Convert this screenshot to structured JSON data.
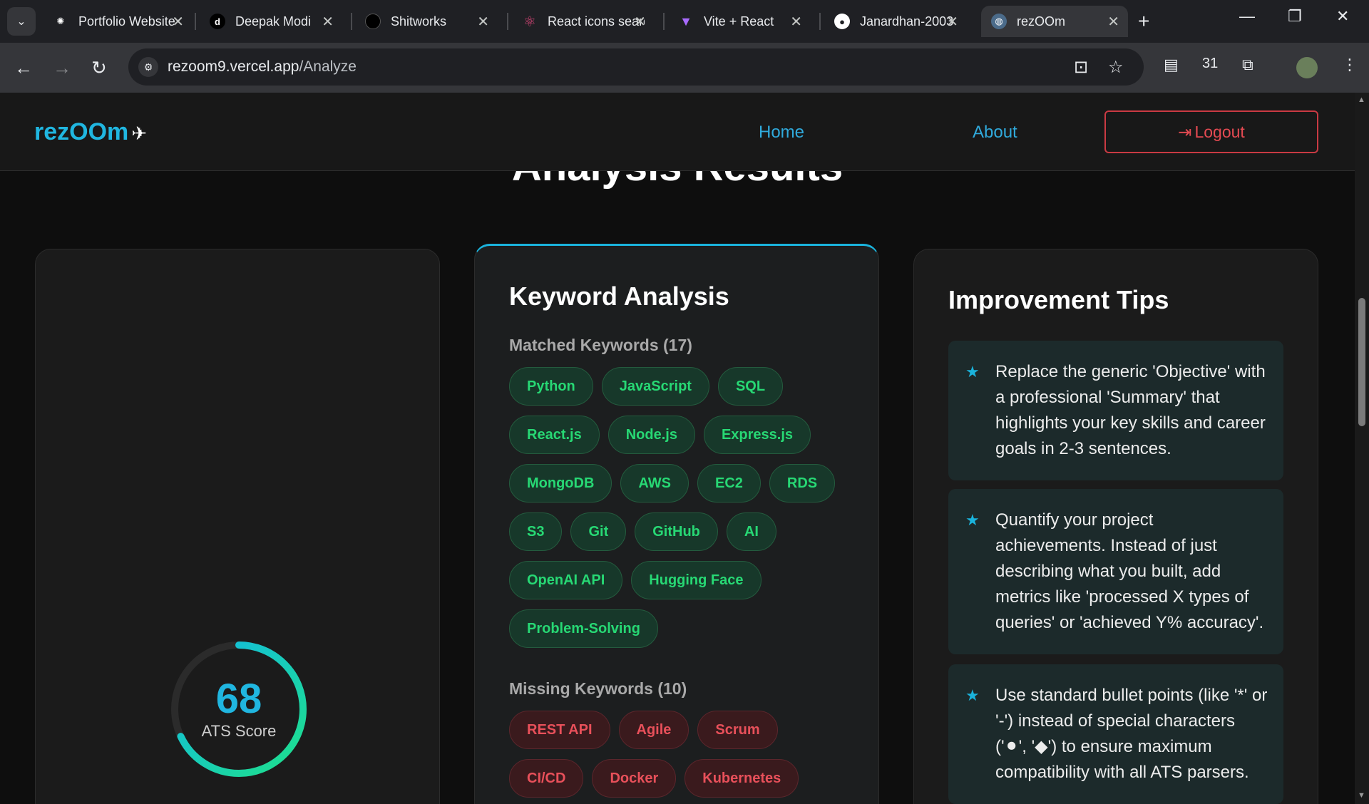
{
  "browser": {
    "tabs": [
      {
        "title": "Portfolio Website",
        "icon": "openai-icon"
      },
      {
        "title": "Deepak Modi",
        "icon": "d-letter-icon"
      },
      {
        "title": "Shitworks",
        "icon": "circle-logo-icon"
      },
      {
        "title": "React icons search",
        "icon": "react-icon"
      },
      {
        "title": "Vite + React",
        "icon": "vite-icon"
      },
      {
        "title": "Janardhan-2003",
        "icon": "github-icon"
      },
      {
        "title": "rezOOm",
        "icon": "globe-telescope-icon",
        "active": true
      }
    ],
    "url_host": "rezoom9.vercel.app",
    "url_path": "/Analyze",
    "extension_badge": "31"
  },
  "app": {
    "logo": "rezOOm",
    "nav": {
      "home": "Home",
      "about": "About",
      "logout": "Logout"
    }
  },
  "page": {
    "title": "Analysis Results",
    "ats": {
      "score": 68,
      "label": "ATS Score",
      "fraction": 0.68
    }
  },
  "keywords": {
    "title": "Keyword Analysis",
    "matched_heading": "Matched Keywords (17)",
    "matched": [
      "Python",
      "JavaScript",
      "SQL",
      "React.js",
      "Node.js",
      "Express.js",
      "MongoDB",
      "AWS",
      "EC2",
      "RDS",
      "S3",
      "Git",
      "GitHub",
      "AI",
      "OpenAI API",
      "Hugging Face",
      "Problem-Solving"
    ],
    "missing_heading": "Missing Keywords (10)",
    "missing": [
      "REST API",
      "Agile",
      "Scrum",
      "CI/CD",
      "Docker",
      "Kubernetes"
    ]
  },
  "tips": {
    "title": "Improvement Tips",
    "items": [
      "Replace the generic 'Objective' with a professional 'Summary' that highlights your key skills and career goals in 2-3 sentences.",
      "Quantify your project achievements. Instead of just describing what you built, add metrics like 'processed X types of queries' or 'achieved Y% accuracy'.",
      "Use standard bullet points (like '*' or '-') instead of special characters ('⚫', '◆') to ensure maximum compatibility with all ATS parsers."
    ]
  },
  "colors": {
    "accent": "#1ab3dc",
    "matched": "#27d874",
    "missing": "#e8505a",
    "gauge_start": "#1ee08a",
    "gauge_end": "#12b8e8"
  }
}
